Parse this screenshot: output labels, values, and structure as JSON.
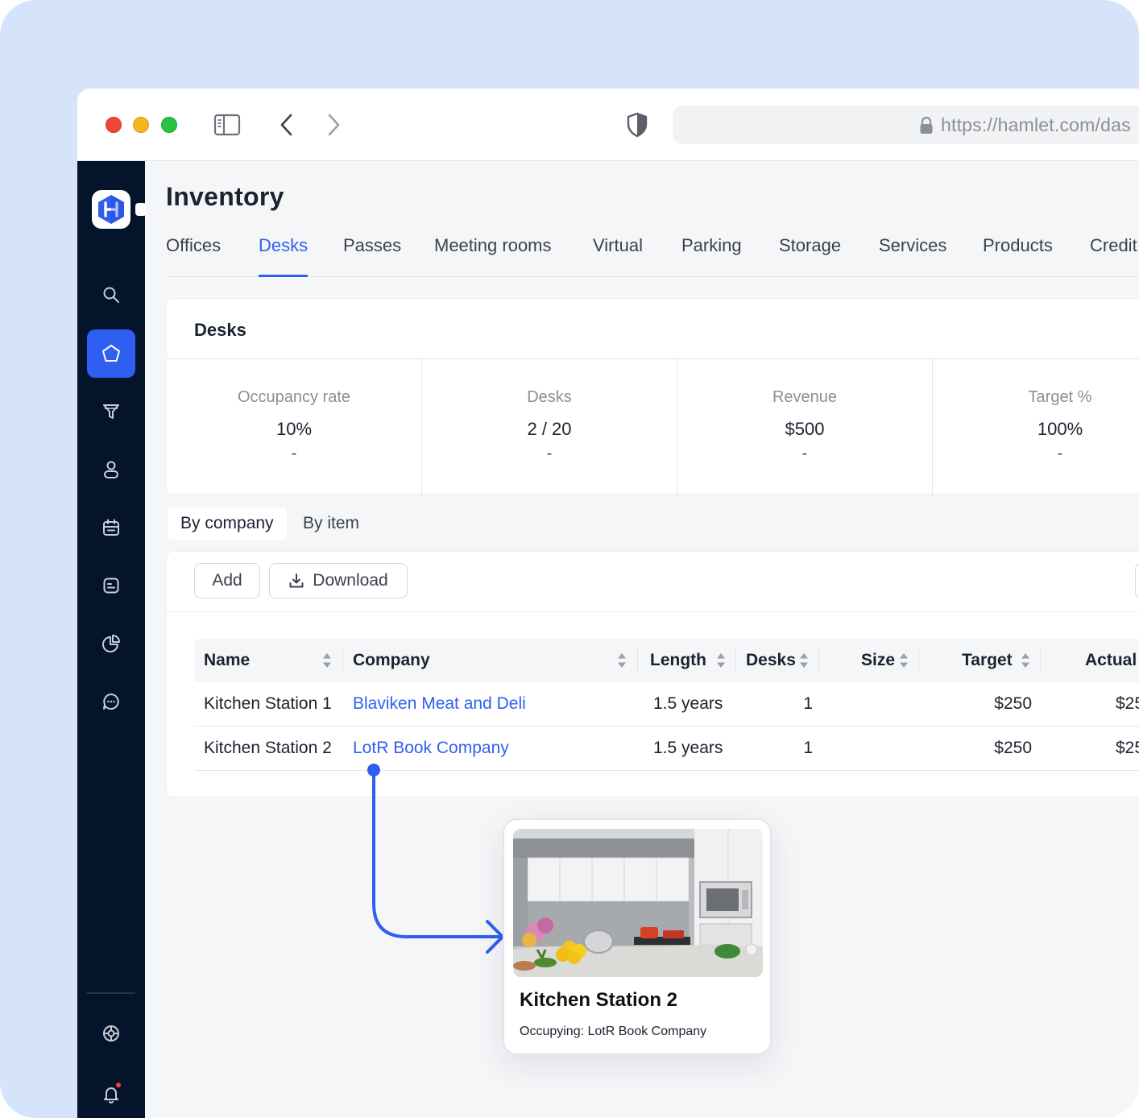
{
  "browser": {
    "url": "https://hamlet.com/das"
  },
  "page": {
    "title": "Inventory"
  },
  "tabs": [
    {
      "label": "Offices"
    },
    {
      "label": "Desks"
    },
    {
      "label": "Passes"
    },
    {
      "label": "Meeting rooms"
    },
    {
      "label": "Virtual"
    },
    {
      "label": "Parking"
    },
    {
      "label": "Storage"
    },
    {
      "label": "Services"
    },
    {
      "label": "Products"
    },
    {
      "label": "Credit"
    }
  ],
  "stats": {
    "title": "Desks",
    "items": [
      {
        "label": "Occupancy rate",
        "value": "10%",
        "sub": "-"
      },
      {
        "label": "Desks",
        "value": "2 / 20",
        "sub": "-"
      },
      {
        "label": "Revenue",
        "value": "$500",
        "sub": "-"
      },
      {
        "label": "Target %",
        "value": "100%",
        "sub": "-"
      }
    ]
  },
  "view_toggle": {
    "by_company": "By company",
    "by_item": "By item"
  },
  "toolbar": {
    "add_label": "Add",
    "download_label": "Download"
  },
  "table": {
    "headers": {
      "name": "Name",
      "company": "Company",
      "length": "Length",
      "desks": "Desks",
      "size": "Size",
      "target": "Target",
      "actual": "Actual"
    },
    "rows": [
      {
        "name": "Kitchen Station 1",
        "company": "Blaviken Meat and Deli",
        "length": "1.5 years",
        "desks": "1",
        "size": "",
        "target": "$250",
        "actual": "$25"
      },
      {
        "name": "Kitchen Station 2",
        "company": "LotR Book Company",
        "length": "1.5 years",
        "desks": "1",
        "size": "",
        "target": "$250",
        "actual": "$25"
      }
    ]
  },
  "popup": {
    "title": "Kitchen Station 2",
    "occupying_label": "Occupying:",
    "occupying_value": "LotR Book Company"
  },
  "colors": {
    "accent": "#2f5ff0",
    "sidebar": "#04142b",
    "frame_bg": "#d6e4fb"
  },
  "icons": {
    "sidebar": [
      "search-icon",
      "home-icon",
      "filter-icon",
      "user-icon",
      "calendar-icon",
      "document-icon",
      "chart-icon",
      "chat-icon",
      "support-icon",
      "bell-icon"
    ]
  }
}
